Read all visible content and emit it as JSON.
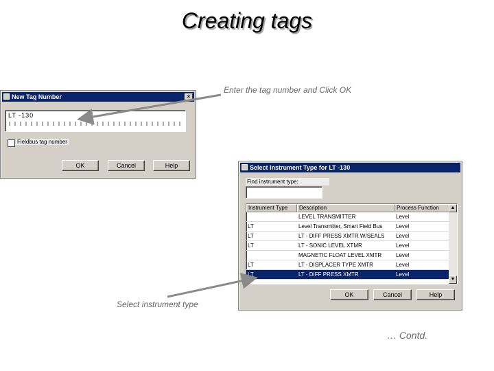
{
  "slide": {
    "title": "Creating tags",
    "caption_tag": "Enter the tag number  and Click OK",
    "caption_type": "Select instrument type",
    "footer": "… Contd."
  },
  "dialog1": {
    "title": "New Tag Number",
    "tag_value": "LT -130",
    "fieldbus_label": "Fieldbus tag number",
    "ok_label": "OK",
    "cancel_label": "Cancel",
    "help_label": "Help"
  },
  "dialog2": {
    "title": "Select Instrument Type for LT  -130",
    "find_label": "Find instrument type:",
    "find_value": "",
    "columns": [
      "Instrument Type",
      "Description",
      "Process Function"
    ],
    "rows": [
      {
        "type": "",
        "desc": "LEVEL TRANSMITTER",
        "func": "Level"
      },
      {
        "type": "LT",
        "desc": "Level Transmitter, Smart Field Bus",
        "func": "Level"
      },
      {
        "type": "LT",
        "desc": "LT - DIFF PRESS XMTR W/SEALS",
        "func": "Level"
      },
      {
        "type": "LT",
        "desc": "LT - SONIC LEVEL XTMR",
        "func": "Level"
      },
      {
        "type": "",
        "desc": "MAGNETIC FLOAT LEVEL XMTR",
        "func": "Level"
      },
      {
        "type": "LT",
        "desc": "LT - DISPLACER TYPE XMTR",
        "func": "Level"
      },
      {
        "type": "LT",
        "desc": "LT - DIFF PRESS XMTR",
        "func": "Level",
        "selected": true
      }
    ],
    "ok_label": "OK",
    "cancel_label": "Cancel",
    "help_label": "Help"
  },
  "icons": {
    "close": "×",
    "scroll_up": "▲",
    "scroll_down": "▼"
  }
}
